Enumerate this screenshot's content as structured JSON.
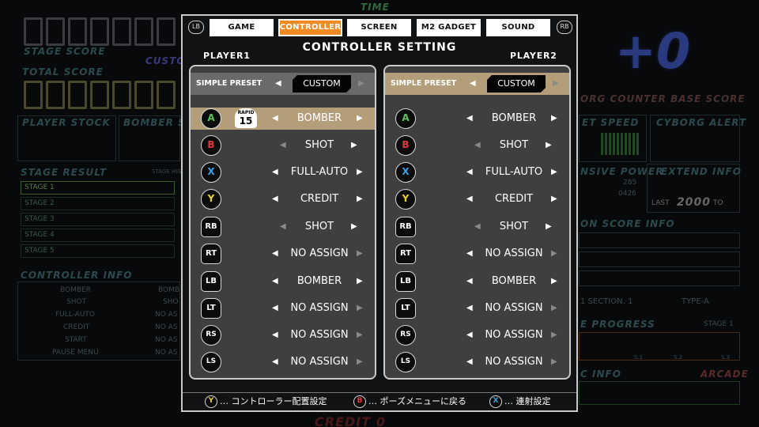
{
  "background": {
    "stage_score_label": "STAGE SCORE",
    "total_score_label": "TOTAL SCORE",
    "custom_label": "CUSTO",
    "player_stock_label": "PLAYER STOCK",
    "bomber_stock_label": "BOMBER ST",
    "stage_result_label": "STAGE RESULT",
    "stage_high_label": "STAGE HIG",
    "stages": [
      "STAGE 1",
      "STAGE 2",
      "STAGE 3",
      "STAGE 4",
      "STAGE 5"
    ],
    "controller_info_label": "CONTROLLER INFO",
    "controller_info_items": [
      "BOMBER",
      "SHOT",
      "FULL-AUTO",
      "CREDIT",
      "START",
      "PAUSE MENU"
    ],
    "controller_info_items2": [
      "BOMB",
      "SHO",
      "NO AS",
      "NO AS",
      "NO AS",
      "NO AS"
    ],
    "big_score": "+0",
    "cyborg_counter_label": "ORG COUNTER BASE SCORE",
    "speed_label": "ET SPEED",
    "cyborg_alert_label": "CYBORG ALERT",
    "defensive_power_label": "NSIVE POWER",
    "extend_info_label": "EXTEND INFO",
    "power_val_1": "285",
    "power_val_2": "0426",
    "last_label": "LAST",
    "last_value": "2000",
    "to_label": "TO",
    "bonus_score_label": "ON SCORE INFO",
    "section_info": "1   SECTION. 1",
    "type_label": "TYPE-A",
    "progress_label": "E PROGRESS",
    "stage_progress_label": "STAGE 1",
    "progress_ticks": [
      "S.1",
      "S.2",
      "S.3"
    ],
    "music_label": "C INFO",
    "arcade_label": "ARCADE",
    "time_label": "TIME",
    "credit_label": "CREDIT 0"
  },
  "dialog": {
    "lb_label": "LB",
    "rb_label": "RB",
    "tabs": [
      {
        "label": "GAME SETTING",
        "active": false
      },
      {
        "label": "CONTROLLER",
        "active": true
      },
      {
        "label": "SCREEN",
        "active": false
      },
      {
        "label": "M2 GADGET",
        "active": false
      },
      {
        "label": "SOUND",
        "active": false
      }
    ],
    "title": "CONTROLLER SETTING",
    "player1_label": "PLAYER1",
    "player2_label": "PLAYER2",
    "preset_label": "SIMPLE PRESET",
    "left_arrow": "◀",
    "right_arrow": "▶",
    "player1": {
      "preset_value": "CUSTOM",
      "rows": [
        {
          "button": "A",
          "value": "BOMBER",
          "rapid": "15",
          "rapid_label": "RAPID"
        },
        {
          "button": "B",
          "value": "SHOT"
        },
        {
          "button": "X",
          "value": "FULL-AUTO"
        },
        {
          "button": "Y",
          "value": "CREDIT"
        },
        {
          "button": "RB",
          "value": "SHOT"
        },
        {
          "button": "RT",
          "value": "NO ASSIGN"
        },
        {
          "button": "LB",
          "value": "BOMBER"
        },
        {
          "button": "LT",
          "value": "NO ASSIGN"
        },
        {
          "button": "RS",
          "value": "NO ASSIGN"
        },
        {
          "button": "LS",
          "value": "NO ASSIGN"
        }
      ]
    },
    "player2": {
      "preset_value": "CUSTOM",
      "rows": [
        {
          "button": "A",
          "value": "BOMBER"
        },
        {
          "button": "B",
          "value": "SHOT"
        },
        {
          "button": "X",
          "value": "FULL-AUTO"
        },
        {
          "button": "Y",
          "value": "CREDIT"
        },
        {
          "button": "RB",
          "value": "SHOT"
        },
        {
          "button": "RT",
          "value": "NO ASSIGN"
        },
        {
          "button": "LB",
          "value": "BOMBER"
        },
        {
          "button": "LT",
          "value": "NO ASSIGN"
        },
        {
          "button": "RS",
          "value": "NO ASSIGN"
        },
        {
          "button": "LS",
          "value": "NO ASSIGN"
        }
      ]
    },
    "footer": [
      {
        "button": "Y",
        "text": "… コントローラー配置設定"
      },
      {
        "button": "B",
        "text": "… ポーズメニューに戻る"
      },
      {
        "button": "X",
        "text": "… 連射設定"
      }
    ]
  },
  "colors": {
    "accent_orange": "#f08a23",
    "highlight_tan": "#b39e79",
    "panel_gray": "#3f3f3f",
    "button_a": "#5cc15c",
    "button_b": "#e23a3a",
    "button_x": "#3aa0e8",
    "button_y": "#e8d23a"
  }
}
